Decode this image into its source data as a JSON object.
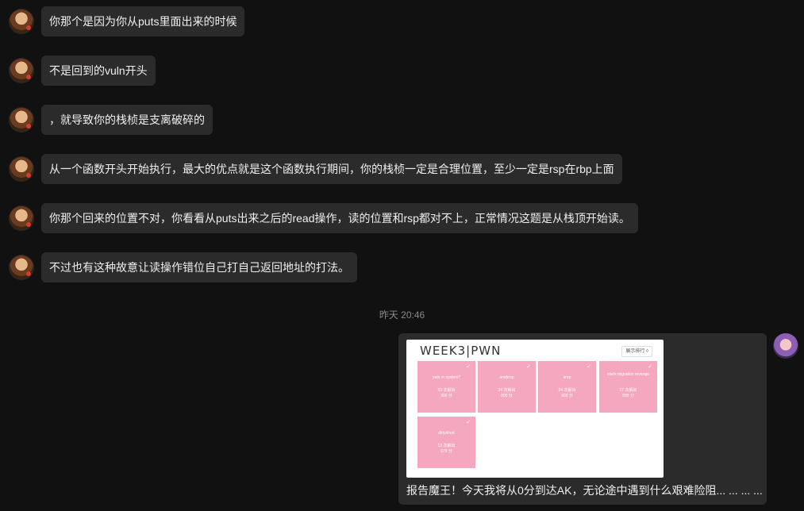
{
  "messages": [
    {
      "text": "你那个是因为你从puts里面出来的时候"
    },
    {
      "text": "不是回到的vuln开头"
    },
    {
      "text": "，就导致你的栈桢是支离破碎的"
    },
    {
      "text": "从一个函数开头开始执行，最大的优点就是这个函数执行期间，你的栈桢一定是合理位置，至少一定是rsp在rbp上面"
    },
    {
      "text": "你那个回来的位置不对，你看看从puts出来之后的read操作，读的位置和rsp都对不上，正常情况这题是从栈顶开始读。"
    },
    {
      "text": "不过也有这种故意让读操作错位自己打自己返回地址的打法。"
    }
  ],
  "timestamp": "昨天 20:46",
  "shared": {
    "title": "WEEK3|PWN",
    "toggle": "展示排行 ◊",
    "challenges": [
      {
        "name": "puts or system?",
        "solves": "53 次解出",
        "points": "306 分"
      },
      {
        "name": "orwbrop",
        "solves": "34 次解出",
        "points": "800 分"
      },
      {
        "name": "srop",
        "solves": "24 次解出",
        "points": "903 分"
      },
      {
        "name": "stack migration revenge",
        "solves": "17 次解出",
        "points": "930 分"
      },
      {
        "name": "dirtyshort",
        "solves": "13 次解出",
        "points": "979 分"
      }
    ],
    "caption": "报告魔王！今天我将从0分到达AK，无论途中遇到什么艰难险阻... ... ... ..."
  },
  "colors": {
    "background": "#111111",
    "bubble": "#2b2b2b",
    "tile": "#f4a7bf"
  }
}
